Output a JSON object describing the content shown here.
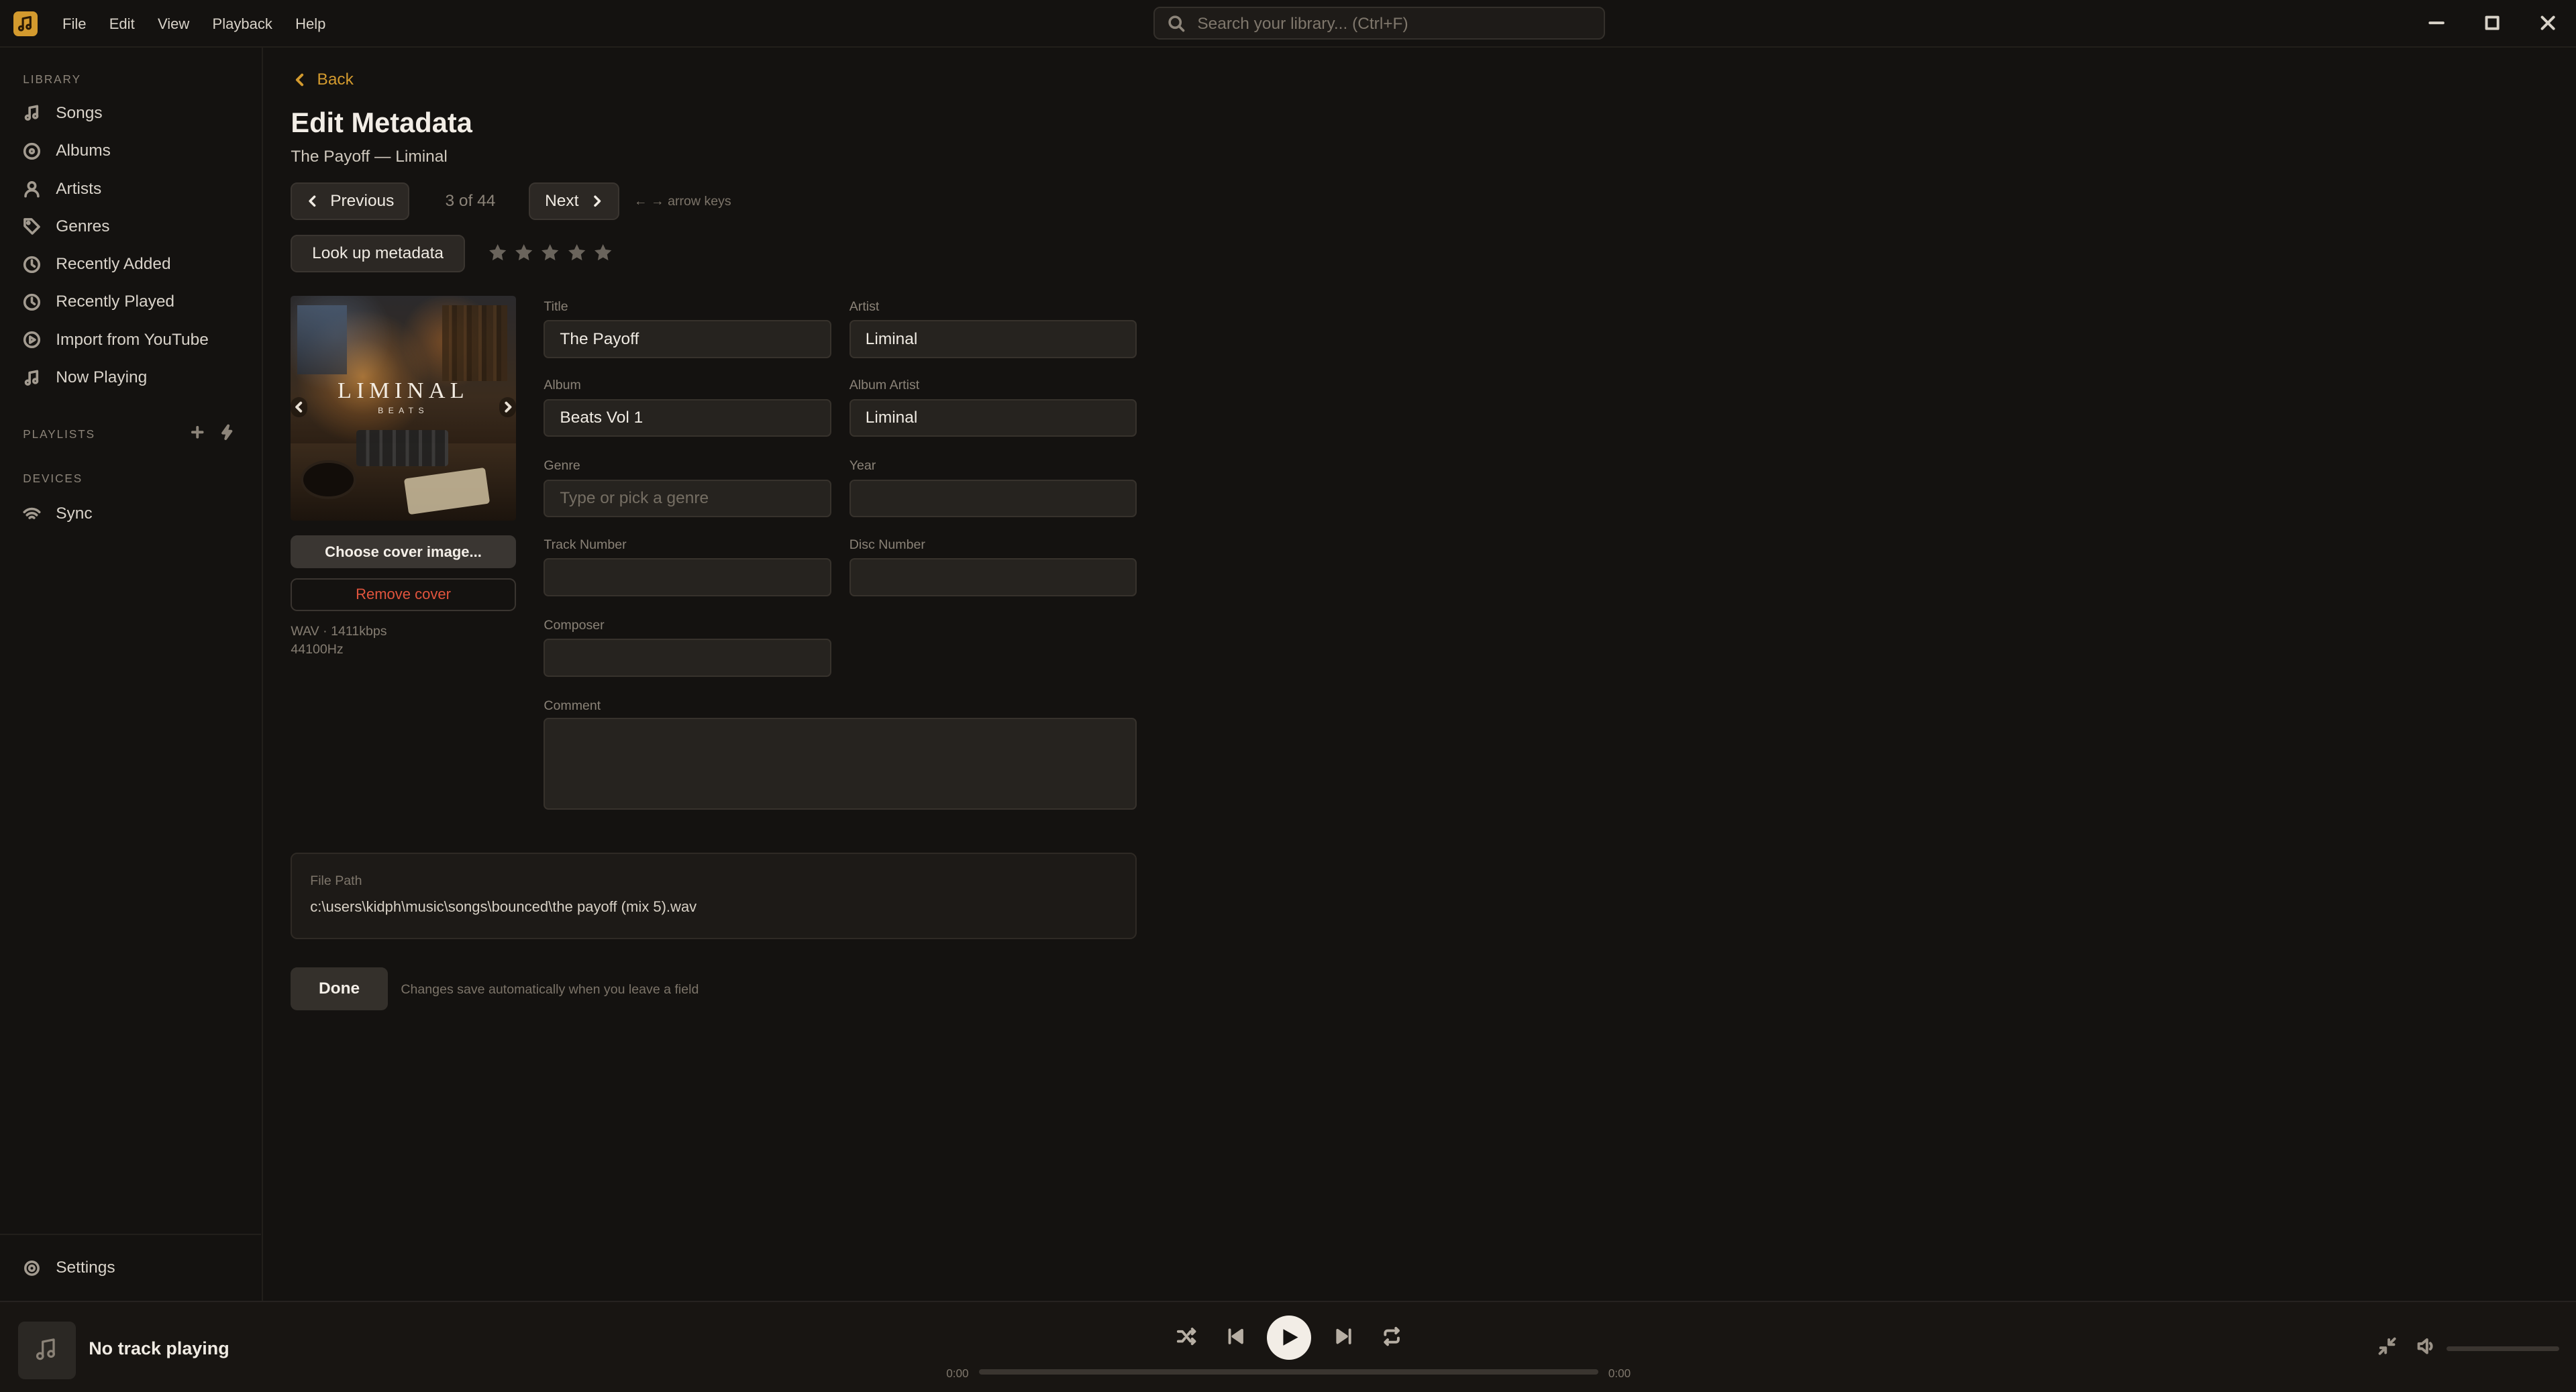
{
  "menu": [
    "File",
    "Edit",
    "View",
    "Playback",
    "Help"
  ],
  "search": {
    "placeholder": "Search your library... (Ctrl+F)"
  },
  "sidebar": {
    "library_label": "LIBRARY",
    "items": [
      {
        "label": "Songs",
        "icon": "music-note-icon"
      },
      {
        "label": "Albums",
        "icon": "disc-icon"
      },
      {
        "label": "Artists",
        "icon": "user-icon"
      },
      {
        "label": "Genres",
        "icon": "tag-icon"
      },
      {
        "label": "Recently Added",
        "icon": "clock-icon"
      },
      {
        "label": "Recently Played",
        "icon": "clock-icon"
      },
      {
        "label": "Import from YouTube",
        "icon": "import-icon"
      },
      {
        "label": "Now Playing",
        "icon": "music-note-icon"
      }
    ],
    "playlists_label": "PLAYLISTS",
    "devices_label": "DEVICES",
    "devices": [
      {
        "label": "Sync",
        "icon": "wifi-icon"
      }
    ],
    "settings_label": "Settings"
  },
  "editor": {
    "back_label": "Back",
    "title": "Edit Metadata",
    "subtitle": "The Payoff — Liminal",
    "prev_label": "Previous",
    "counter": "3 of 44",
    "next_label": "Next",
    "nav_hint": "← → arrow keys",
    "lookup_label": "Look up metadata",
    "rating": {
      "value": 0,
      "max": 5
    },
    "cover": {
      "brand": "LIMINAL",
      "brand_sub": "BEATS"
    },
    "choose_cover_label": "Choose cover image...",
    "remove_cover_label": "Remove cover",
    "format_line1": "WAV · 1411kbps",
    "format_line2": "44100Hz",
    "fields": {
      "title": {
        "label": "Title",
        "value": "The Payoff"
      },
      "artist": {
        "label": "Artist",
        "value": "Liminal"
      },
      "album": {
        "label": "Album",
        "value": "Beats Vol 1"
      },
      "album_artist": {
        "label": "Album Artist",
        "value": "Liminal"
      },
      "genre": {
        "label": "Genre",
        "value": "",
        "placeholder": "Type or pick a genre"
      },
      "year": {
        "label": "Year",
        "value": ""
      },
      "track_number": {
        "label": "Track Number",
        "value": ""
      },
      "disc_number": {
        "label": "Disc Number",
        "value": ""
      },
      "composer": {
        "label": "Composer",
        "value": ""
      },
      "comment": {
        "label": "Comment",
        "value": ""
      }
    },
    "file_path_label": "File Path",
    "file_path": "c:\\users\\kidph\\music\\songs\\bounced\\the payoff (mix 5).wav",
    "done_label": "Done",
    "done_hint": "Changes save automatically when you leave a field"
  },
  "player": {
    "now_playing": "No track playing",
    "time_current": "0:00",
    "time_total": "0:00",
    "progress": 0,
    "volume": 0
  },
  "colors": {
    "accent": "#d39a2e",
    "danger": "#e1543d",
    "background": "#141210"
  }
}
